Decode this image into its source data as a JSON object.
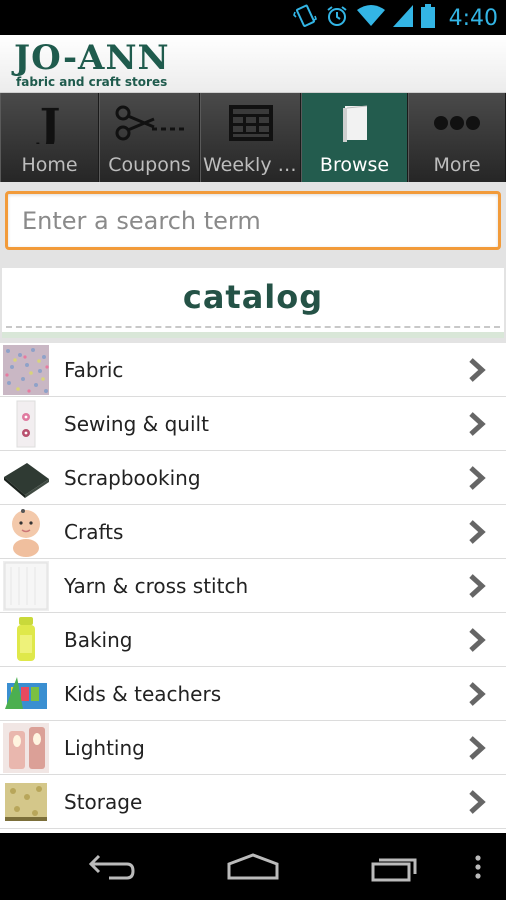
{
  "status_bar": {
    "time": "4:40",
    "icons": [
      "vibrate-icon",
      "alarm-icon",
      "wifi-icon",
      "signal-icon",
      "battery-icon"
    ],
    "color": "#33b5e5"
  },
  "header": {
    "logo_main": "JO-ANN",
    "logo_sub": "fabric and craft stores",
    "brand_color": "#1f5b4d"
  },
  "tabs": [
    {
      "label": "Home",
      "icon": "j-logo-icon",
      "active": false
    },
    {
      "label": "Coupons",
      "icon": "scissors-icon",
      "active": false
    },
    {
      "label": "Weekly Ad",
      "icon": "newspaper-icon",
      "active": false
    },
    {
      "label": "Browse",
      "icon": "book-icon",
      "active": true
    },
    {
      "label": "More",
      "icon": "more-dots-icon",
      "active": false
    }
  ],
  "search": {
    "placeholder": "Enter a search term",
    "value": ""
  },
  "catalog": {
    "title": "catalog"
  },
  "categories": [
    {
      "label": "Fabric",
      "thumb": "fabric-thumbnail"
    },
    {
      "label": "Sewing & quilt",
      "thumb": "sewing-thumbnail"
    },
    {
      "label": "Scrapbooking",
      "thumb": "scrapbook-thumbnail"
    },
    {
      "label": "Crafts",
      "thumb": "crafts-thumbnail"
    },
    {
      "label": "Yarn & cross stitch",
      "thumb": "yarn-thumbnail"
    },
    {
      "label": "Baking",
      "thumb": "baking-thumbnail"
    },
    {
      "label": "Kids & teachers",
      "thumb": "kids-thumbnail"
    },
    {
      "label": "Lighting",
      "thumb": "lighting-thumbnail"
    },
    {
      "label": "Storage",
      "thumb": "storage-thumbnail"
    }
  ],
  "colors": {
    "accent_orange": "#f29b3a",
    "active_tab": "#235c4e"
  },
  "nav_bar": {
    "icons": [
      "back-icon",
      "home-icon",
      "recent-apps-icon",
      "menu-overflow-icon"
    ]
  }
}
